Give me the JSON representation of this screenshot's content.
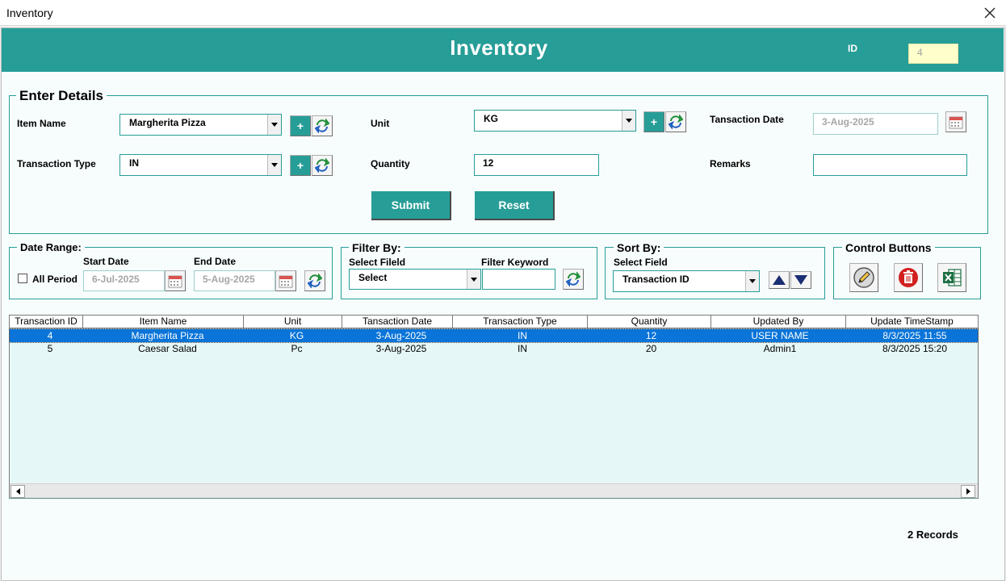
{
  "window": {
    "title": "Inventory"
  },
  "header": {
    "title": "Inventory",
    "id_label": "ID",
    "id_value": "4"
  },
  "details": {
    "title": "Enter Details",
    "item_name_label": "Item Name",
    "item_name_value": "Margherita Pizza",
    "unit_label": "Unit",
    "unit_value": "KG",
    "transaction_date_label": "Tansaction Date",
    "transaction_date_value": "3-Aug-2025",
    "transaction_type_label": "Transaction Type",
    "transaction_type_value": "IN",
    "quantity_label": "Quantity",
    "quantity_value": "12",
    "remarks_label": "Remarks",
    "remarks_value": "",
    "add_label": "+",
    "submit_label": "Submit",
    "reset_label": "Reset"
  },
  "date_range": {
    "title": "Date Range:",
    "all_period_label": "All Period",
    "all_period_checked": false,
    "start_label": "Start Date",
    "start_value": "6-Jul-2025",
    "end_label": "End Date",
    "end_value": "5-Aug-2025"
  },
  "filter": {
    "title": "Filter By:",
    "field_label": "Select Fileld",
    "field_value": "Select",
    "keyword_label": "Filter Keyword",
    "keyword_value": ""
  },
  "sort": {
    "title": "Sort By:",
    "field_label": "Select Field",
    "field_value": "Transaction ID"
  },
  "controls": {
    "title": "Control Buttons"
  },
  "table": {
    "columns": [
      "Transaction ID",
      "Item Name",
      "Unit",
      "Tansaction Date",
      "Transaction Type",
      "Quantity",
      "Updated By",
      "Update TimeStamp"
    ],
    "rows": [
      [
        "4",
        "Margherita Pizza",
        "KG",
        "3-Aug-2025",
        "IN",
        "12",
        "USER NAME",
        "8/3/2025 11:55"
      ],
      [
        "5",
        "Caesar Salad",
        "Pc",
        "3-Aug-2025",
        "IN",
        "20",
        "Admin1",
        "8/3/2025 15:20"
      ]
    ],
    "selected_row": 0
  },
  "status": {
    "records": "2 Records"
  },
  "colors": {
    "accent": "#279d97",
    "selection": "#0a74d8",
    "id_background": "#ffffcc"
  }
}
